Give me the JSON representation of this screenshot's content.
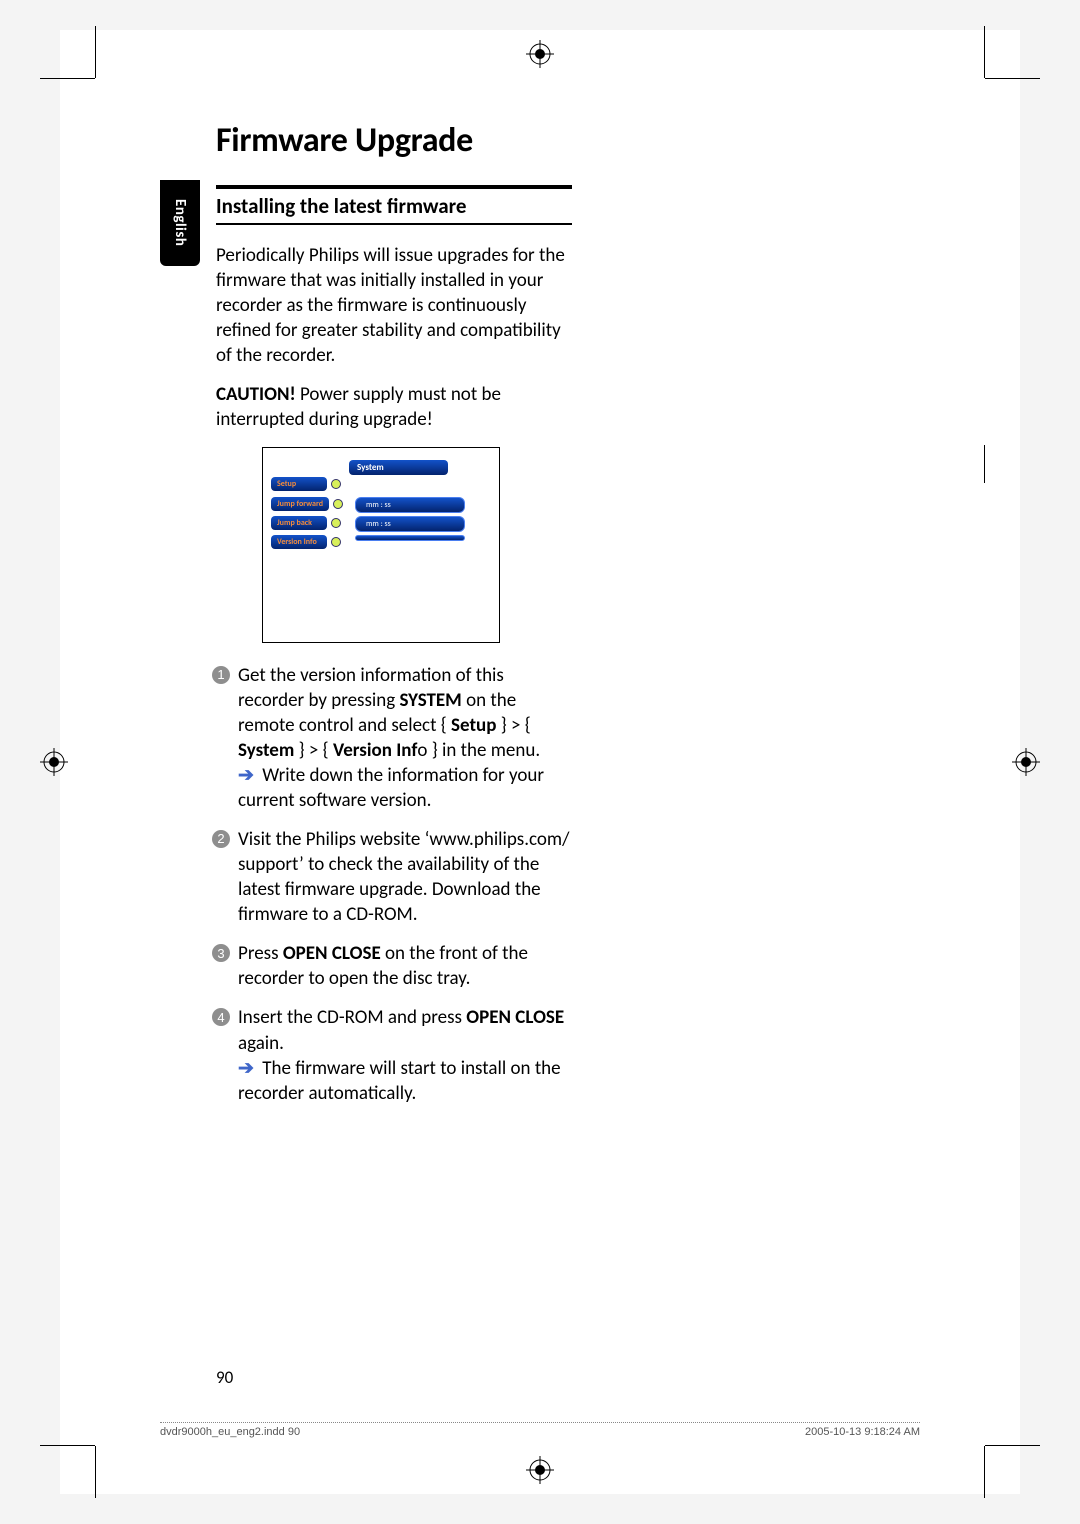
{
  "page": {
    "title": "Firmware Upgrade",
    "side_tab": "English",
    "page_number": "90",
    "section_heading": "Installing the latest firmware",
    "intro_para_html": "Periodically Philips will issue upgrades for the firmware that was initially installed in your recorder as the firmware is continuously refined for greater stability and compatibility of the recorder.",
    "caution_html": "<strong>CAUTION!</strong> Power supply must not be interrupted during upgrade!"
  },
  "menu": {
    "top": "System",
    "rows": [
      {
        "left": "Setup",
        "right": ""
      },
      {
        "left": "Jump forward",
        "right": "mm : ss"
      },
      {
        "left": "Jump back",
        "right": "mm : ss"
      },
      {
        "left": "Version Info",
        "right": ""
      }
    ]
  },
  "steps": [
    {
      "n": "1",
      "body_html": "Get the version information of this recorder by pressing <strong>SYSTEM</strong> on the remote control and select { <strong>Setup</strong> } > { <strong>System</strong> } > { <strong>Version Inf</strong>o } in the menu.",
      "result": "Write down the information for your current software version."
    },
    {
      "n": "2",
      "body_html": "Visit the Philips website ‘www.philips.com/ support’ to check the availability of the latest firmware upgrade. Download the firmware to a CD-ROM."
    },
    {
      "n": "3",
      "body_html": "Press <strong>OPEN CLOSE</strong> on the front of the recorder to open the disc tray."
    },
    {
      "n": "4",
      "body_html": "Insert the CD-ROM and press <strong>OPEN CLOSE</strong> again.",
      "result": "The firmware will start to install on the recorder automatically."
    }
  ],
  "footer": {
    "left": "dvdr9000h_eu_eng2.indd   90",
    "right": "2005-10-13   9:18:24 AM"
  }
}
